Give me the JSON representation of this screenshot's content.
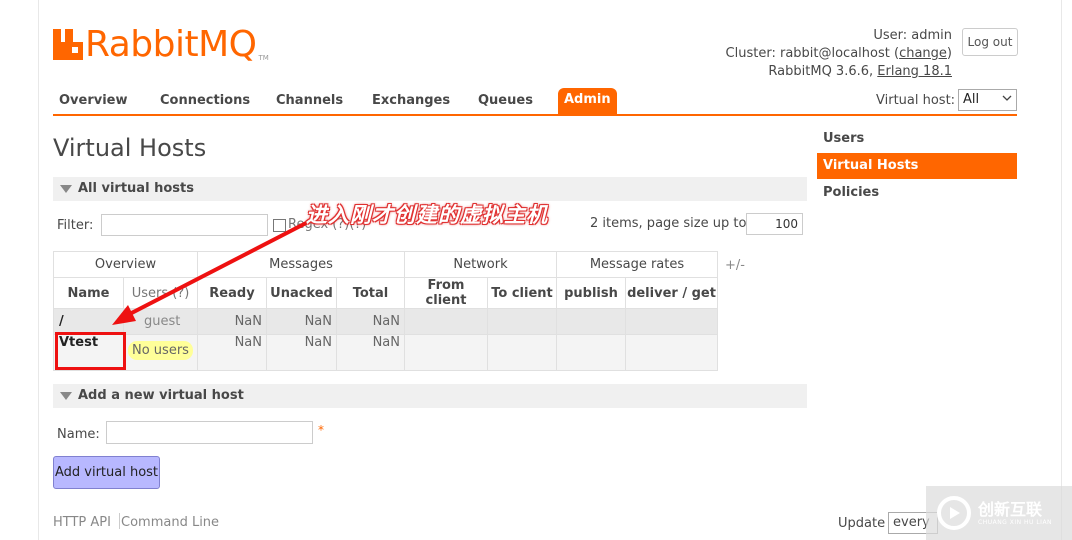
{
  "logo": {
    "text": "RabbitMQ",
    "tm": "TM"
  },
  "header": {
    "user_label": "User:",
    "user_value": "admin",
    "cluster_label": "Cluster:",
    "cluster_value": "rabbit@localhost",
    "change_link": "change",
    "version_text": "RabbitMQ 3.6.6,",
    "erlang_link": "Erlang 18.1",
    "logout": "Log out"
  },
  "nav": {
    "tabs": [
      {
        "label": "Overview"
      },
      {
        "label": "Connections"
      },
      {
        "label": "Channels"
      },
      {
        "label": "Exchanges"
      },
      {
        "label": "Queues"
      },
      {
        "label": "Admin"
      }
    ],
    "vhost_label": "Virtual host:",
    "vhost_value": "All"
  },
  "page_title": "Virtual Hosts",
  "all_vhosts": {
    "section_title": "All virtual hosts",
    "filter_label": "Filter:",
    "regex_label": "Regex (?)(?)",
    "items_text": "2 items, page size up to",
    "page_size": "100",
    "plus_minus": "+/-",
    "group_headers": [
      "Overview",
      "Messages",
      "Network",
      "Message rates"
    ],
    "column_headers": [
      "Name",
      "Users (?)",
      "Ready",
      "Unacked",
      "Total",
      "From client",
      "To client",
      "publish",
      "deliver / get"
    ],
    "rows": [
      {
        "name": "/",
        "users": "guest",
        "ready": "NaN",
        "unacked": "NaN",
        "total": "NaN"
      },
      {
        "name": "Vtest",
        "users": "No users",
        "ready": "NaN",
        "unacked": "NaN",
        "total": "NaN"
      }
    ]
  },
  "annotation": {
    "text": "进入刚才创建的虚拟主机"
  },
  "add_vhost": {
    "section_title": "Add a new virtual host",
    "name_label": "Name:",
    "required_mark": "*",
    "button": "Add virtual host"
  },
  "footer": {
    "http_api": "HTTP API",
    "command_line": "Command Line",
    "update_label": "Update",
    "update_value": "every"
  },
  "sidebar": {
    "items": [
      {
        "label": "Users"
      },
      {
        "label": "Virtual Hosts"
      },
      {
        "label": "Policies"
      }
    ]
  },
  "watermark": {
    "text": "创新互联",
    "sub": "CHUANG XIN HU LIAN"
  },
  "colors": {
    "accent": "#ff6600",
    "button": "#b8b8ff",
    "annotation": "#e11111"
  }
}
